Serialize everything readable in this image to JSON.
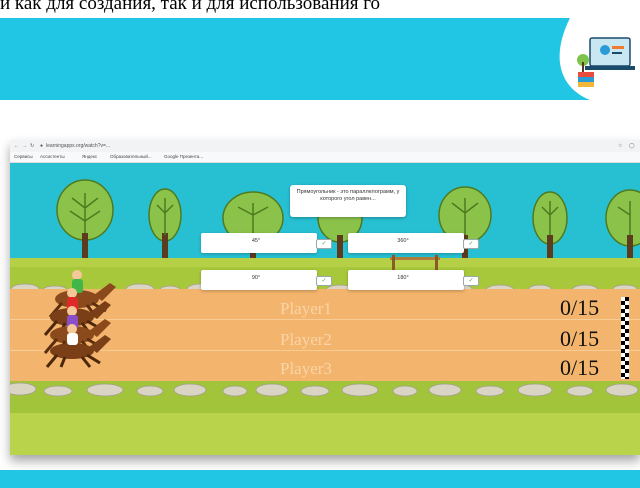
{
  "slide": {
    "caption": "и как для создания, так и для использования го",
    "colors": {
      "banner": "#20c6e4",
      "footer": "#20c6e4"
    }
  },
  "browser": {
    "url": "learningapps.org/watch?v=...",
    "bookmarks": [
      "Сервисы",
      "Ассистенты",
      "Яндекс",
      "Образовательный...",
      "Google Презента..."
    ]
  },
  "game": {
    "question": "Прямоугольник - это параллелограмм, у которого угол равен...",
    "answers": [
      {
        "text": "45°",
        "check": "✓"
      },
      {
        "text": "360°",
        "check": "✓"
      },
      {
        "text": "90°",
        "check": "✓"
      },
      {
        "text": "180°",
        "check": "✓"
      }
    ],
    "players": [
      {
        "name": "Player1",
        "score": "0/15"
      },
      {
        "name": "Player2",
        "score": "0/15"
      },
      {
        "name": "Player3",
        "score": "0/15"
      }
    ],
    "colors": {
      "sky": "#27c0d3",
      "track": "#f3b46d",
      "grass": "#a8c83c"
    }
  }
}
